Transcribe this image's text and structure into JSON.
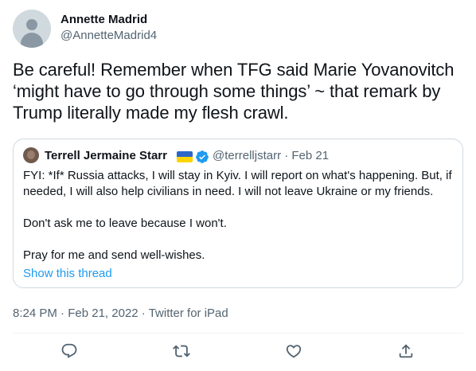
{
  "author": {
    "name": "Annette Madrid",
    "handle": "@AnnetteMadrid4"
  },
  "tweet": {
    "text": "Be careful! Remember when TFG said Marie Yovanovitch ‘might have to go through some things’ ~ that remark by Trump literally made my flesh crawl."
  },
  "quoted": {
    "name": "Terrell Jermaine Starr",
    "flag_icon": "ukraine-flag",
    "verified_icon": "verified-badge",
    "handle_date": "@terrelljstarr · Feb 21",
    "paragraphs": [
      "FYI: *If* Russia attacks, I will stay in Kyiv. I will report on what's happening. But, if needed, I will also help civilians in need. I will not leave Ukraine or my friends.",
      "Don't ask me to leave because I won't.",
      "Pray for me and send well-wishes."
    ],
    "show_thread": "Show this thread"
  },
  "meta": {
    "time": "8:24 PM",
    "sep1": " · ",
    "date": "Feb 21, 2022",
    "sep2": " · ",
    "source": "Twitter for iPad"
  },
  "actions": [
    {
      "icon": "reply-icon"
    },
    {
      "icon": "retweet-icon"
    },
    {
      "icon": "like-icon"
    },
    {
      "icon": "share-icon"
    }
  ],
  "colors": {
    "text": "#0f1419",
    "secondary": "#536471",
    "link": "#1d9bf0",
    "border": "#cfd9de"
  }
}
